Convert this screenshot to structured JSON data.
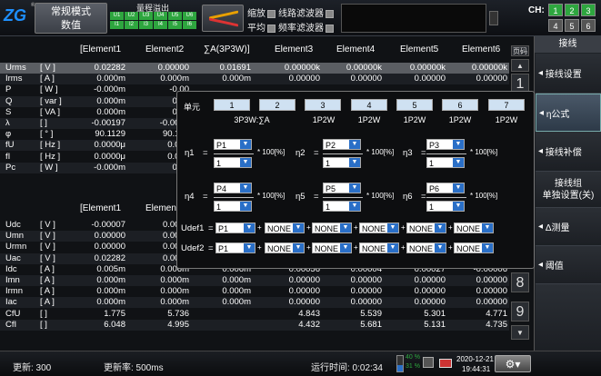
{
  "topbar": {
    "logo_text": "ZG",
    "mode_line1": "常规模式",
    "mode_line2": "数值",
    "range_title": "量程溢出",
    "range_cells": [
      "U1",
      "U2",
      "U3",
      "U4",
      "U5",
      "U6",
      "U7",
      "I1",
      "I2",
      "I3",
      "I4",
      "I5",
      "I6",
      "I7"
    ],
    "filter_zoom": "缩放",
    "filter_avg": "平均",
    "filter_line": "线路滤波器",
    "filter_freq": "频率滤波器",
    "ch_label": "CH:",
    "ch_buttons": [
      "1",
      "2",
      "3",
      "4",
      "5",
      "6"
    ]
  },
  "colors": {
    "green": "#2ea63f",
    "accent_blue": "#2a6fc7"
  },
  "sidebar": {
    "title": "接线",
    "items": [
      "接线设置",
      "η公式",
      "接线补偿",
      "接线组单独设置(关)",
      "Δ测量",
      "阈值"
    ],
    "item4_line1": "接线组",
    "item4_line2": "单独设置(关)"
  },
  "table": {
    "headers": [
      "[Element1",
      "Element2",
      "∑A(3P3W)]",
      "Element3",
      "Element4",
      "Element5",
      "Element6"
    ],
    "page_label": "页码",
    "rows": [
      [
        "Urms",
        "[ V ]",
        "0.02282",
        "0.00000",
        "0.01691",
        "0.00000k",
        "0.00000k",
        "0.00000k",
        "0.00000k"
      ],
      [
        "Irms",
        "[ A ]",
        "0.000m",
        "0.000m",
        "0.000m",
        "0.00000",
        "0.00000",
        "0.00000",
        "0.00000"
      ],
      [
        "P",
        "[ W ]",
        "-0.000m",
        "-0.00",
        "",
        " ",
        "",
        "",
        ""
      ],
      [
        "Q",
        "[ var ]",
        "0.000m",
        "0.00",
        "",
        "",
        "",
        "",
        ""
      ],
      [
        "S",
        "[ VA ]",
        "0.000m",
        "0.00",
        "",
        "",
        "",
        "",
        ""
      ],
      [
        "λ",
        "[   ]",
        "-0.00197",
        "-0.0029",
        "",
        "",
        "",
        "",
        ""
      ],
      [
        "φ",
        "[ ° ]",
        "90.1129",
        "90.166",
        "",
        "",
        "",
        "",
        ""
      ],
      [
        "fU",
        "[ Hz ]",
        "0.0000μ",
        "0.000",
        "",
        "",
        "",
        "",
        ""
      ],
      [
        "fI",
        "[ Hz ]",
        "0.0000μ",
        "0.000",
        "",
        "",
        "",
        "",
        ""
      ],
      [
        "Pc",
        "[ W ]",
        "-0.000m",
        "0.00",
        "",
        "",
        "",
        "",
        ""
      ]
    ],
    "headers2": [
      "[Element1",
      "Elemen"
    ],
    "rows2": [
      [
        "Udc",
        "[ V ]",
        "-0.00007",
        "0.0000",
        "",
        "",
        "",
        "",
        ""
      ],
      [
        "Umn",
        "[ V ]",
        "0.00000",
        "0.0000",
        "",
        "",
        "",
        "",
        ""
      ],
      [
        "Urmn",
        "[ V ]",
        "0.00000",
        "0.0000",
        "",
        "",
        "",
        "",
        ""
      ],
      [
        "Uac",
        "[ V ]",
        "0.02282",
        "0.0000",
        "",
        "",
        "",
        "",
        ""
      ],
      [
        "Idc",
        "[ A ]",
        "0.005m",
        "0.006m",
        "0.006m",
        "0.00056",
        "0.00004",
        "0.00027",
        "-0.00006"
      ],
      [
        "Imn",
        "[ A ]",
        "0.000m",
        "0.000m",
        "0.000m",
        "0.00000",
        "0.00000",
        "0.00000",
        "0.00000"
      ],
      [
        "Irmn",
        "[ A ]",
        "0.000m",
        "0.000m",
        "0.000m",
        "0.00000",
        "0.00000",
        "0.00000",
        "0.00000"
      ],
      [
        "Iac",
        "[ A ]",
        "0.000m",
        "0.000m",
        "0.000m",
        "0.00000",
        "0.00000",
        "0.00000",
        "0.00000"
      ],
      [
        "CfU",
        "[   ]",
        "1.775",
        "5.736",
        "",
        "4.843",
        "5.539",
        "5.301",
        "4.771"
      ],
      [
        "CfI",
        "[   ]",
        "6.048",
        "4.995",
        "",
        "4.432",
        "5.681",
        "5.131",
        "4.735"
      ]
    ],
    "page_numbers": [
      "1",
      "8",
      "9"
    ]
  },
  "dialog": {
    "unit_label": "单元",
    "units": [
      "1",
      "2",
      "3",
      "4",
      "5",
      "6",
      "7"
    ],
    "wiring_group1": "3P3W:∑A",
    "wirings": [
      "1P2W",
      "1P2W",
      "1P2W",
      "1P2W",
      "1P2W"
    ],
    "eta": [
      {
        "label": "η1",
        "num": "P1",
        "den": "1"
      },
      {
        "label": "η2",
        "num": "P2",
        "den": "1"
      },
      {
        "label": "η3",
        "num": "P3",
        "den": "1"
      },
      {
        "label": "η4",
        "num": "P4",
        "den": "1"
      },
      {
        "label": "η5",
        "num": "P5",
        "den": "1"
      },
      {
        "label": "η6",
        "num": "P6",
        "den": "1"
      }
    ],
    "percent_suffix": "* 100[%]",
    "udef1_label": "Udef1",
    "udef2_label": "Udef2",
    "udef_first": "P1",
    "udef_none": "NONE",
    "eq": "=",
    "plus": "+"
  },
  "status": {
    "update_label": "更新: 300",
    "rate_label": "更新率: 500ms",
    "run_label": "运行时间: 0:02:34",
    "bar1": "40 %",
    "bar2": "31 %",
    "date": "2020-12-21",
    "time": "19:44:31"
  }
}
